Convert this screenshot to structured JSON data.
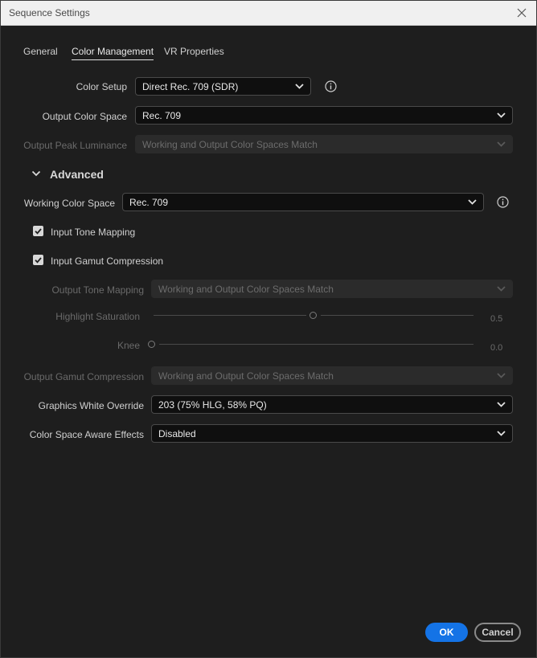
{
  "window": {
    "title": "Sequence Settings"
  },
  "tabs": [
    {
      "label": "General"
    },
    {
      "label": "Color Management"
    },
    {
      "label": "VR Properties"
    }
  ],
  "fields": {
    "color_setup": {
      "label": "Color Setup",
      "value": "Direct Rec. 709 (SDR)"
    },
    "output_color_space": {
      "label": "Output Color Space",
      "value": "Rec. 709"
    },
    "output_peak_luminance": {
      "label": "Output Peak Luminance",
      "value": "Working and Output Color Spaces Match"
    },
    "working_color_space": {
      "label": "Working Color Space",
      "value": "Rec. 709"
    },
    "output_tone_mapping": {
      "label": "Output Tone Mapping",
      "value": "Working and Output Color Spaces Match"
    },
    "highlight_saturation": {
      "label": "Highlight Saturation",
      "value": "0.5",
      "level": 0.5
    },
    "knee": {
      "label": "Knee",
      "value": "0.0",
      "level": 0.0
    },
    "output_gamut_compression": {
      "label": "Output Gamut Compression",
      "value": "Working and Output Color Spaces Match"
    },
    "graphics_white_override": {
      "label": "Graphics White Override",
      "value": "203 (75% HLG, 58% PQ)"
    },
    "color_space_aware_effects": {
      "label": "Color Space Aware Effects",
      "value": "Disabled"
    }
  },
  "advanced": {
    "label": "Advanced",
    "expanded": true
  },
  "checkboxes": {
    "input_tone_mapping": {
      "label": "Input Tone Mapping",
      "checked": true
    },
    "input_gamut_compression": {
      "label": "Input Gamut Compression",
      "checked": true
    }
  },
  "buttons": {
    "ok": "OK",
    "cancel": "Cancel"
  },
  "icons": {
    "close": "close-icon",
    "info": "info-icon",
    "chevron": "chevron-down-icon",
    "check": "checkmark-icon"
  },
  "colors": {
    "accent": "#1473e6",
    "background": "#1e1e1e",
    "titlebar": "#f0f0f0"
  }
}
